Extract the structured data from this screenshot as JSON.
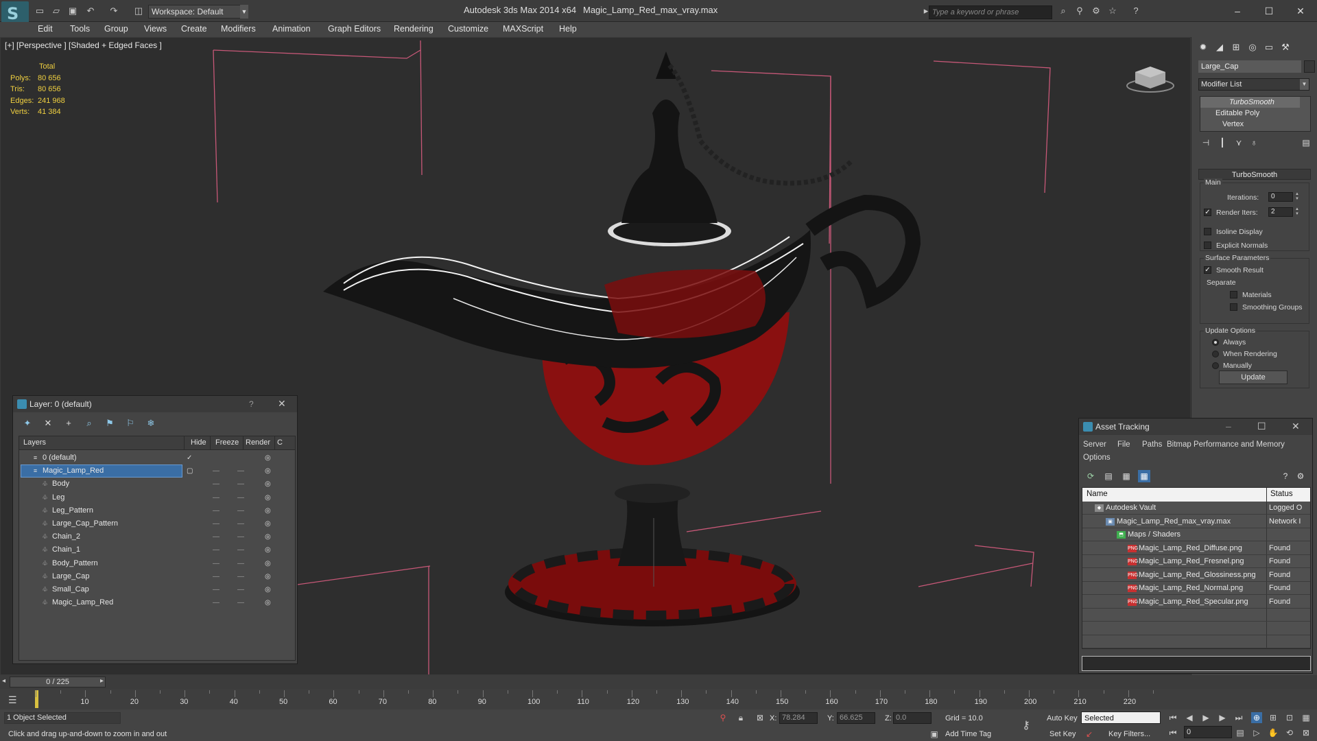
{
  "titlebar": {
    "workspace": "Workspace: Default",
    "app_title": "Autodesk 3ds Max  2014 x64",
    "document_title": "Magic_Lamp_Red_max_vray.max",
    "search_placeholder": "Type a keyword or phrase"
  },
  "menu": [
    "Edit",
    "Tools",
    "Group",
    "Views",
    "Create",
    "Modifiers",
    "Animation",
    "Graph Editors",
    "Rendering",
    "Customize",
    "MAXScript",
    "Help"
  ],
  "viewport": {
    "label": "[+] [Perspective ] [Shaded + Edged Faces ]",
    "stats": {
      "header": "Total",
      "rows": [
        {
          "label": "Polys:",
          "value": "80 656"
        },
        {
          "label": "Tris:",
          "value": "80 656"
        },
        {
          "label": "Edges:",
          "value": "241 968"
        },
        {
          "label": "Verts:",
          "value": "41 384"
        }
      ]
    }
  },
  "command_panel": {
    "object_name": "Large_Cap",
    "modifier_list": "Modifier List",
    "stack": [
      "TurboSmooth",
      "Editable Poly",
      "Vertex"
    ],
    "rollout_title": "TurboSmooth",
    "main_label": "Main",
    "iterations_label": "Iterations:",
    "iterations_value": "0",
    "render_iters_label": "Render Iters:",
    "render_iters_value": "2",
    "render_iters_checked": true,
    "isoline_display": "Isoline Display",
    "explicit_normals": "Explicit Normals",
    "surface_params_label": "Surface Parameters",
    "smooth_result": "Smooth Result",
    "separate_label": "Separate",
    "materials": "Materials",
    "smoothing_groups": "Smoothing Groups",
    "update_options_label": "Update Options",
    "update_options": [
      "Always",
      "When Rendering",
      "Manually"
    ],
    "update_options_selected": "Always",
    "update_button": "Update"
  },
  "layer_explorer": {
    "title": "Layer: 0 (default)",
    "help": "?",
    "columns": [
      "Layers",
      "Hide",
      "Freeze",
      "Render",
      "C"
    ],
    "rows": [
      {
        "name": "0 (default)",
        "level": 0,
        "type": "layer"
      },
      {
        "name": "Magic_Lamp_Red",
        "level": 0,
        "type": "layer",
        "selected": true
      },
      {
        "name": "Body",
        "level": 1,
        "type": "object"
      },
      {
        "name": "Leg",
        "level": 1,
        "type": "object"
      },
      {
        "name": "Leg_Pattern",
        "level": 1,
        "type": "object"
      },
      {
        "name": "Large_Cap_Pattern",
        "level": 1,
        "type": "object"
      },
      {
        "name": "Chain_2",
        "level": 1,
        "type": "object"
      },
      {
        "name": "Chain_1",
        "level": 1,
        "type": "object"
      },
      {
        "name": "Body_Pattern",
        "level": 1,
        "type": "object"
      },
      {
        "name": "Large_Cap",
        "level": 1,
        "type": "object"
      },
      {
        "name": "Small_Cap",
        "level": 1,
        "type": "object"
      },
      {
        "name": "Magic_Lamp_Red",
        "level": 1,
        "type": "object"
      }
    ]
  },
  "asset_tracking": {
    "title": "Asset Tracking",
    "menu": [
      "Server",
      "File",
      "Paths",
      "Bitmap Performance and Memory",
      "Options"
    ],
    "columns": [
      "Name",
      "Status"
    ],
    "rows": [
      {
        "name": "Autodesk Vault",
        "status": "Logged O",
        "level": 0,
        "icon": "vault"
      },
      {
        "name": "Magic_Lamp_Red_max_vray.max",
        "status": "Network I",
        "level": 1,
        "icon": "max"
      },
      {
        "name": "Maps / Shaders",
        "status": "",
        "level": 2,
        "icon": "maps"
      },
      {
        "name": "Magic_Lamp_Red_Diffuse.png",
        "status": "Found",
        "level": 3,
        "icon": "png"
      },
      {
        "name": "Magic_Lamp_Red_Fresnel.png",
        "status": "Found",
        "level": 3,
        "icon": "png"
      },
      {
        "name": "Magic_Lamp_Red_Glossiness.png",
        "status": "Found",
        "level": 3,
        "icon": "png"
      },
      {
        "name": "Magic_Lamp_Red_Normal.png",
        "status": "Found",
        "level": 3,
        "icon": "png"
      },
      {
        "name": "Magic_Lamp_Red_Specular.png",
        "status": "Found",
        "level": 3,
        "icon": "png"
      }
    ]
  },
  "timeline": {
    "frame_counter": "0 / 225",
    "ticks": [
      "10",
      "20",
      "30",
      "40",
      "50",
      "60",
      "70",
      "80",
      "90",
      "100",
      "110",
      "120",
      "130",
      "140",
      "150",
      "160",
      "170",
      "180",
      "190",
      "200",
      "210",
      "220"
    ]
  },
  "status_bar": {
    "selection": "1 Object Selected",
    "prompt": "Click and drag up-and-down to zoom in and out",
    "x_label": "X:",
    "x_value": "78.284",
    "y_label": "Y:",
    "y_value": "66.625",
    "z_label": "Z:",
    "z_value": "0.0",
    "grid": "Grid = 10.0",
    "add_time_tag": "Add Time Tag",
    "auto_key": "Auto Key",
    "set_key": "Set Key",
    "selected_dropdown": "Selected",
    "key_filters": "Key Filters...",
    "current_frame": "0"
  },
  "colors": {
    "lamp_red": "#8a1010",
    "lamp_dark": "#141414",
    "grid_pink": "#d06080",
    "selection_blue": "#3a6ea5",
    "stats_yellow": "#f0d040"
  }
}
